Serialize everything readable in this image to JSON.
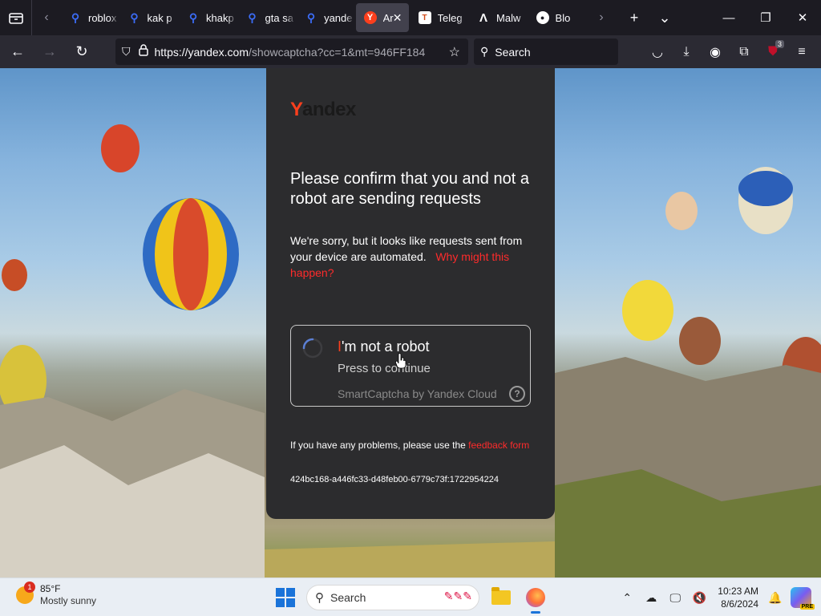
{
  "tabs": [
    {
      "label": "roblox",
      "favicon": "search-icon"
    },
    {
      "label": "kak p",
      "favicon": "search-icon"
    },
    {
      "label": "khakp",
      "favicon": "search-icon"
    },
    {
      "label": "gta sa",
      "favicon": "search-icon"
    },
    {
      "label": "yande",
      "favicon": "search-icon"
    },
    {
      "label": "Ar",
      "favicon": "yandex-icon",
      "active": true
    },
    {
      "label": "Teleg",
      "favicon": "telegram-icon"
    },
    {
      "label": "Malw",
      "favicon": "malwarebytes-icon"
    },
    {
      "label": "Blo",
      "favicon": "blog-icon"
    }
  ],
  "urlbar": {
    "url_main": "https://yandex.com",
    "url_rest": "/showcaptcha?cc=1&mt=946FF184"
  },
  "searchbar": {
    "placeholder": "Search"
  },
  "extensions_badge": "3",
  "captcha": {
    "logo": "Yandex",
    "heading": "Please confirm that you and not a robot are sending requests",
    "description": "We're sorry, but it looks like requests sent from your device are automated.",
    "why_link": "Why might this happen?",
    "robot_title_first": "I",
    "robot_title_rest": "'m not a robot",
    "robot_subtitle": "Press to continue",
    "robot_footer": "SmartCaptcha by Yandex Cloud",
    "help": "?",
    "problems_text": "If you have any problems, please use the",
    "feedback_link": "feedback form",
    "request_id": "424bc168-a446fc33-d48feb00-6779c73f:1722954224"
  },
  "taskbar": {
    "weather_temp": "85°F",
    "weather_cond": "Mostly sunny",
    "weather_badge": "1",
    "search_placeholder": "Search",
    "time": "10:23 AM",
    "date": "8/6/2024",
    "copilot_badge": "PRE"
  },
  "colors": {
    "accent_red": "#fc3f1d",
    "card_bg": "#2c2c2e",
    "browser_bg": "#1c1b22",
    "toolbar_bg": "#2b2a33"
  }
}
